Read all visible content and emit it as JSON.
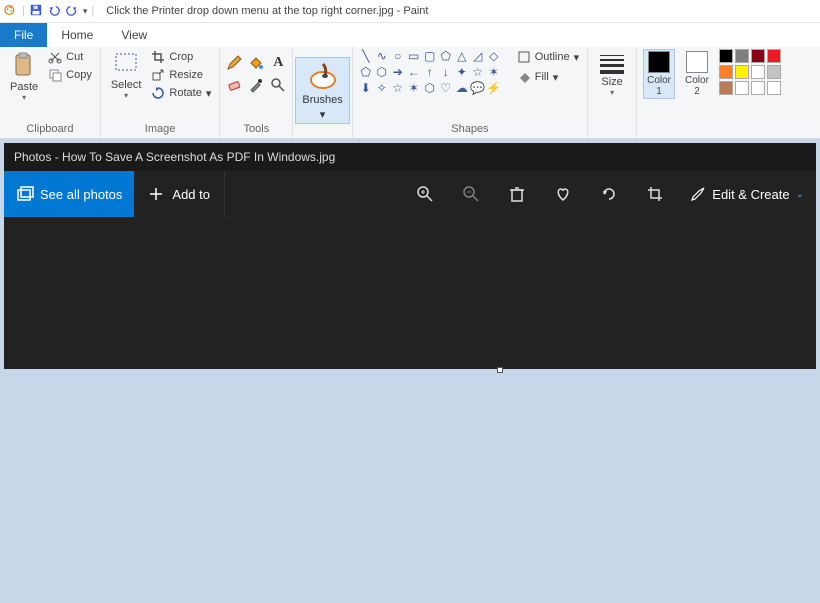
{
  "titlebar": {
    "filename": "Click the Printer drop down menu at the top right corner.jpg - Paint"
  },
  "tabs": {
    "file": "File",
    "home": "Home",
    "view": "View"
  },
  "ribbon": {
    "clipboard": {
      "paste": "Paste",
      "cut": "Cut",
      "copy": "Copy",
      "label": "Clipboard"
    },
    "image": {
      "select": "Select",
      "crop": "Crop",
      "resize": "Resize",
      "rotate": "Rotate",
      "label": "Image"
    },
    "tools": {
      "label": "Tools"
    },
    "brushes": {
      "label": "Brushes"
    },
    "shapes": {
      "outline": "Outline",
      "fill": "Fill",
      "label": "Shapes"
    },
    "size": {
      "label": "Size"
    },
    "colors": {
      "color1": "Color\n1",
      "color2": "Color\n2",
      "color1_hex": "#000000",
      "color2_hex": "#ffffff",
      "palette": [
        "#000000",
        "#7f7f7f",
        "#880015",
        "#ed1c24",
        "#ff7f27",
        "#fff200",
        "#ffffff",
        "#c3c3c3",
        "#b97a57",
        "#ffffff",
        "#ffffff",
        "#ffffff"
      ]
    }
  },
  "photos": {
    "title": "Photos - How To Save A Screenshot As PDF In Windows.jpg",
    "see_all": "See all photos",
    "add_to": "Add to",
    "edit_create": "Edit & Create"
  }
}
